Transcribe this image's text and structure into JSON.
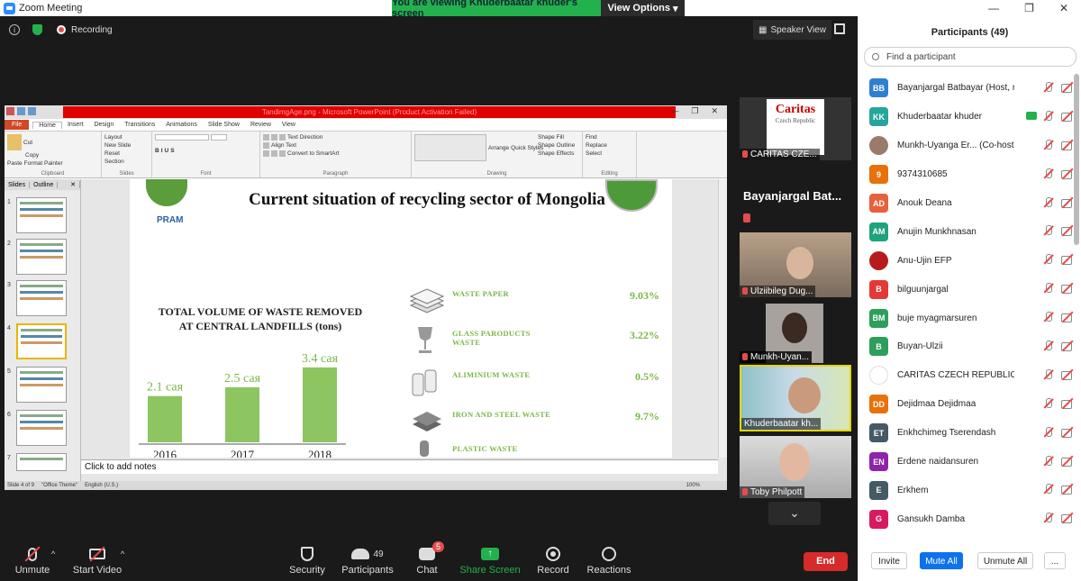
{
  "window": {
    "title": "Zoom Meeting",
    "banner_text": "You are viewing Khuderbaatar khuder's screen",
    "view_options": "View Options",
    "caption_buttons": [
      "—",
      "❐",
      "✕"
    ]
  },
  "top": {
    "recording_label": "Recording",
    "speaker_view_label": "Speaker View"
  },
  "powerpoint": {
    "title": "TandimgAge.png - Microsoft PowerPoint (Product Activation Failed)",
    "tabs": [
      "File",
      "Home",
      "Insert",
      "Design",
      "Transitions",
      "Animations",
      "Slide Show",
      "Review",
      "View"
    ],
    "clipboard": {
      "paste": "Paste",
      "cut": "Cut",
      "copy": "Copy",
      "format_painter": "Format Painter",
      "label": "Clipboard"
    },
    "slides_group": {
      "new_slide": "New Slide",
      "layout": "Layout",
      "reset": "Reset",
      "section": "Section",
      "label": "Slides"
    },
    "font_label": "Font",
    "paragraph": {
      "text_direction": "Text Direction",
      "align_text": "Align Text",
      "convert": "Convert to SmartArt",
      "label": "Paragraph"
    },
    "drawing": {
      "arrange": "Arrange",
      "quick_styles": "Quick Styles",
      "shape_fill": "Shape Fill",
      "shape_outline": "Shape Outline",
      "shape_effects": "Shape Effects",
      "label": "Drawing"
    },
    "editing": {
      "find": "Find",
      "replace": "Replace",
      "select": "Select",
      "label": "Editing"
    },
    "panel_tabs": [
      "Slides",
      "Outline"
    ],
    "thumb_numbers": [
      "1",
      "2",
      "3",
      "4",
      "5",
      "6",
      "7"
    ],
    "notes_placeholder": "Click to add notes",
    "status": {
      "slide": "Slide 4 of 9",
      "theme": "\"Office Theme\"",
      "language": "English (U.S.)",
      "zoom": "100%"
    }
  },
  "slide": {
    "logo_text": "PRAM",
    "title": "Current situation of recycling sector of Mongolia",
    "chart_title_line1": "TOTAL VOLUME OF WASTE REMOVED",
    "chart_title_line2": "AT CENTRAL LANDFILLS  (tons)",
    "waste": [
      {
        "label": "WASTE  PAPER",
        "pct": "9.03%"
      },
      {
        "label": "GLASS PARODUCTS WASTE",
        "pct": "3.22%"
      },
      {
        "label": "ALIMINIUM  WASTE",
        "pct": "0.5%"
      },
      {
        "label": "IRON AND  STEEL  WASTE",
        "pct": "9.7%"
      },
      {
        "label": "PLASTIC WASTE",
        "pct": ""
      }
    ]
  },
  "chart_data": {
    "type": "bar",
    "title": "TOTAL VOLUME OF WASTE REMOVED AT CENTRAL LANDFILLS  (tons)",
    "categories": [
      "2016",
      "2017",
      "2018"
    ],
    "values": [
      2.1,
      2.5,
      3.4
    ],
    "data_labels": [
      "2.1 сая",
      "2.5 сая",
      "3.4 сая"
    ],
    "ylim": [
      0,
      3.6
    ],
    "bar_color": "#8dc561",
    "grid": false
  },
  "videos": {
    "caritas_name": "CARITAS CZE...",
    "caritas_logo": "Caritas",
    "caritas_logo_sub": "Czech Republic",
    "host_name_tile": "Bayanjargal  Bat...",
    "tiles": [
      "Ulziibileg Dug...",
      "Munkh-Uyan...",
      "Khuderbaatar kh...",
      "Toby Philpott"
    ]
  },
  "toolbar": {
    "unmute": "Unmute",
    "start_video": "Start Video",
    "security": "Security",
    "participants": "Participants",
    "participants_count": "49",
    "chat": "Chat",
    "chat_badge": "5",
    "share_screen": "Share Screen",
    "record": "Record",
    "reactions": "Reactions",
    "end": "End"
  },
  "participants": {
    "header": "Participants (49)",
    "search_placeholder": "Find a participant",
    "list": [
      {
        "initials": "BB",
        "name": "Bayanjargal Batbayar (Host, me)",
        "color": "#2f7fd0"
      },
      {
        "initials": "KK",
        "name": "Khuderbaatar khuder",
        "color": "#26a69a"
      },
      {
        "initials": "",
        "name": "Munkh-Uyanga Er... (Co-host)",
        "color": "#9a7b6a"
      },
      {
        "initials": "9",
        "name": "9374310685",
        "color": "#e8710a"
      },
      {
        "initials": "AD",
        "name": "Anouk Deana",
        "color": "#e8613c"
      },
      {
        "initials": "AM",
        "name": "Anujin Munkhnasan",
        "color": "#1fa37a"
      },
      {
        "initials": "",
        "name": "Anu-Ujin EFP",
        "color": "#b71c1c"
      },
      {
        "initials": "B",
        "name": "bilguunjargal",
        "color": "#e53935"
      },
      {
        "initials": "BM",
        "name": "buje myagmarsuren",
        "color": "#2e9e5b"
      },
      {
        "initials": "B",
        "name": "Buyan-Ulzii",
        "color": "#2e9e5b"
      },
      {
        "initials": "",
        "name": "CARITAS CZECH REPUBLIC CARIT...",
        "color": "#ffffff"
      },
      {
        "initials": "DD",
        "name": "Dejidmaa Dejidmaa",
        "color": "#e8710a"
      },
      {
        "initials": "ET",
        "name": "Enkhchimeg Tserendash",
        "color": "#455a64"
      },
      {
        "initials": "EN",
        "name": "Erdene naidansuren",
        "color": "#8e24aa"
      },
      {
        "initials": "E",
        "name": "Erkhem",
        "color": "#455a64"
      },
      {
        "initials": "G",
        "name": "Gansukh Damba",
        "color": "#d81b60"
      }
    ],
    "invite": "Invite",
    "mute_all": "Mute All",
    "unmute_all": "Unmute All",
    "more": "..."
  }
}
